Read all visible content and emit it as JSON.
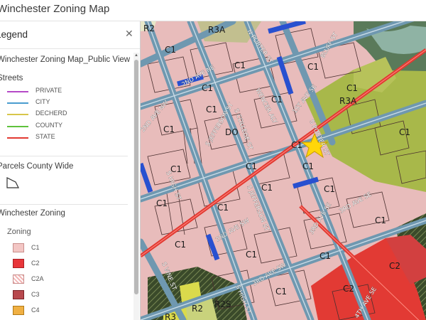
{
  "app": {
    "title": "Winchester Zoning Map"
  },
  "legend": {
    "title": "Legend",
    "layer_title": "Winchester Zoning Map_Public View",
    "streets": {
      "title": "Streets",
      "items": [
        {
          "label": "PRIVATE",
          "color": "#b54ac7"
        },
        {
          "label": "CITY",
          "color": "#4a9ccf"
        },
        {
          "label": "DECHERD",
          "color": "#d8c64a"
        },
        {
          "label": "COUNTY",
          "color": "#5fc23c"
        },
        {
          "label": "STATE",
          "color": "#e23a32"
        }
      ]
    },
    "parcels": {
      "title": "Parcels County Wide"
    },
    "zoning": {
      "title": "Winchester Zoning",
      "subtitle": "Zoning",
      "items": [
        {
          "label": "C1",
          "color": "#f3c6c4"
        },
        {
          "label": "C2",
          "color": "#e8363a"
        },
        {
          "label": "C2A",
          "color": "#f2b5b5"
        },
        {
          "label": "C3",
          "color": "#b8494e"
        },
        {
          "label": "C4",
          "color": "#f0b043"
        }
      ]
    }
  },
  "map": {
    "zone_labels": {
      "z1": "R2",
      "z2": "R3A",
      "z3": "C1",
      "z4": "C1",
      "z5": "C1",
      "z6": "C1",
      "z7": "C1",
      "z8": "R3A",
      "z9": "C1",
      "z10": "C1",
      "z11": "DO",
      "z12": "C1",
      "z13": "C1",
      "z14": "C1",
      "z15": "C1",
      "z16": "C1",
      "z17": "C1",
      "z18": "C1",
      "z19": "C1",
      "z20": "C1",
      "z21": "C1",
      "z22": "C1",
      "z23": "C1",
      "z24": "C2",
      "z25": "C2",
      "z26": "R2",
      "z27": "R2S",
      "z28": "R3",
      "z29": "C1",
      "z30": "C1",
      "z31": "C1"
    },
    "street_labels": {
      "s1": "N PORTER ST",
      "s2": "BLUFF ST",
      "s3": "2ND AVE NE",
      "s4": "1ST AVE SE",
      "s5": "S COLLEGE ST",
      "s6": "S JEFFERSON ST",
      "s7": "S PORTER ST",
      "s8": "S JEFFERSON ST",
      "s9": "S HIGH ST",
      "s10": "2ND AVE SW",
      "s11": "3RD AVE SE",
      "s12": "3RD AVE SE",
      "s13": "S HIGH ST",
      "s14": "3RD AVE SW",
      "s15": "S VINE ST",
      "s16": "WENCER ALY",
      "s17": "2ND AVE NW",
      "s18": "4TH AVE SE"
    }
  }
}
